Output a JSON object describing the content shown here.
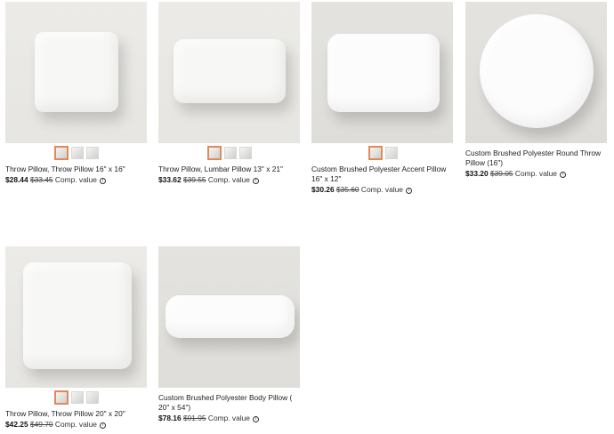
{
  "products": [
    {
      "title": "Throw Pillow, Throw Pillow 16\" x 16\"",
      "price": "$28.44",
      "was": "$33.45",
      "comp": "Comp. value",
      "swatches": 3
    },
    {
      "title": "Throw Pillow, Lumbar Pillow 13\" x 21\"",
      "price": "$33.62",
      "was": "$39.55",
      "comp": "Comp. value",
      "swatches": 3
    },
    {
      "title": "Custom Brushed Polyester Accent Pillow 16\" x 12\"",
      "price": "$30.26",
      "was": "$35.60",
      "comp": "Comp. value",
      "swatches": 2
    },
    {
      "title": "Custom Brushed Polyester Round Throw Pillow (16\")",
      "price": "$33.20",
      "was": "$39.05",
      "comp": "Comp. value",
      "swatches": 0
    },
    {
      "title": "Throw Pillow, Throw Pillow 20\" x 20\"",
      "price": "$42.25",
      "was": "$49.70",
      "comp": "Comp. value",
      "swatches": 3
    },
    {
      "title": "Custom Brushed Polyester Body Pillow ( 20\" x 54\")",
      "price": "$78.16",
      "was": "$91.95",
      "comp": "Comp. value",
      "swatches": 0
    }
  ],
  "icons": {
    "info": "info-circle-icon"
  },
  "colors": {
    "selected_swatch": "#e08a5b"
  }
}
